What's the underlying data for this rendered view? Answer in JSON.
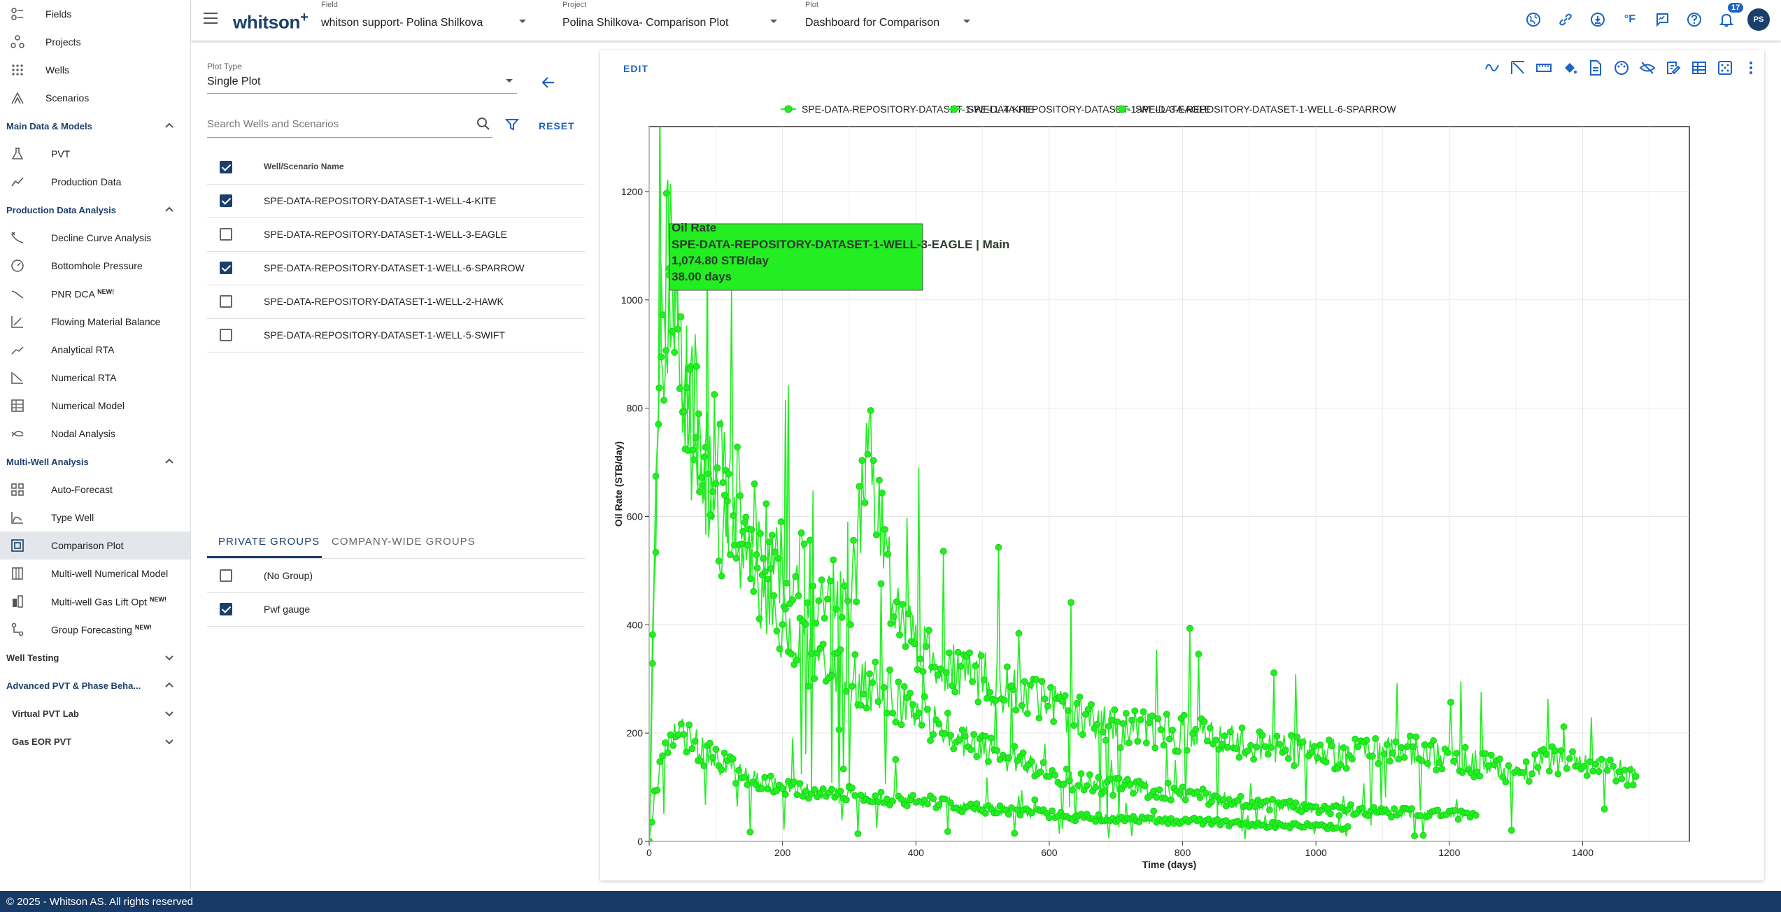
{
  "sidebar": {
    "top_items": [
      {
        "label": "Fields",
        "icon": "fields-icon"
      },
      {
        "label": "Projects",
        "icon": "projects-icon"
      },
      {
        "label": "Wells",
        "icon": "wells-icon"
      },
      {
        "label": "Scenarios",
        "icon": "scenarios-icon"
      }
    ],
    "sections": {
      "main_data": "Main Data & Models",
      "pda": "Production Data Analysis",
      "multi_well": "Multi-Well Analysis",
      "well_testing": "Well Testing",
      "advanced_pvt": "Advanced PVT & Phase Beha...",
      "virtual_pvt": "Virtual PVT Lab",
      "gas_eor": "Gas EOR PVT"
    },
    "main_items": [
      {
        "label": "PVT",
        "icon": "flask-icon"
      },
      {
        "label": "Production Data",
        "icon": "line-chart-icon"
      }
    ],
    "pda_items": [
      {
        "label": "Decline Curve Analysis",
        "icon": "decline-curve-icon"
      },
      {
        "label": "Bottomhole Pressure",
        "icon": "gauge-icon"
      },
      {
        "label": "PNR DCA",
        "badge": "NEW!",
        "icon": "pnr-icon"
      },
      {
        "label": "Flowing Material Balance",
        "icon": "fmb-icon"
      },
      {
        "label": "Analytical RTA",
        "icon": "analytical-rta-icon"
      },
      {
        "label": "Numerical RTA",
        "icon": "numerical-rta-icon"
      },
      {
        "label": "Numerical Model",
        "icon": "grid-model-icon"
      },
      {
        "label": "Nodal Analysis",
        "icon": "nodal-icon"
      }
    ],
    "mwa_items": [
      {
        "label": "Auto-Forecast",
        "icon": "dashboard-grid-icon"
      },
      {
        "label": "Type Well",
        "icon": "type-well-icon"
      },
      {
        "label": "Comparison Plot",
        "icon": "comparison-plot-icon"
      },
      {
        "label": "Multi-well Numerical Model",
        "icon": "multiwell-model-icon"
      },
      {
        "label": "Multi-well Gas Lift Opt",
        "badge": "NEW!",
        "icon": "gas-lift-icon"
      },
      {
        "label": "Group Forecasting",
        "badge": "NEW!",
        "icon": "group-forecast-icon"
      }
    ]
  },
  "header": {
    "logo": "whitson",
    "logo_sup": "+",
    "field": {
      "caption": "Field",
      "value": "whitson support- Polina Shilkova"
    },
    "project": {
      "caption": "Project",
      "value": "Polina Shilkova- Comparison Plot"
    },
    "plot": {
      "caption": "Plot",
      "value": "Dashboard for Comparison"
    },
    "notifications": "17",
    "user_initials": "PS",
    "unit_label": "°F"
  },
  "panel": {
    "plot_type_caption": "Plot Type",
    "plot_type_value": "Single Plot",
    "search_placeholder": "Search Wells and Scenarios",
    "reset_label": "RESET",
    "table_header": "Well/Scenario Name",
    "wells": [
      {
        "name": "SPE-DATA-REPOSITORY-DATASET-1-WELL-4-KITE",
        "checked": true
      },
      {
        "name": "SPE-DATA-REPOSITORY-DATASET-1-WELL-3-EAGLE",
        "checked": false
      },
      {
        "name": "SPE-DATA-REPOSITORY-DATASET-1-WELL-6-SPARROW",
        "checked": true
      },
      {
        "name": "SPE-DATA-REPOSITORY-DATASET-1-WELL-2-HAWK",
        "checked": false
      },
      {
        "name": "SPE-DATA-REPOSITORY-DATASET-1-WELL-5-SWIFT",
        "checked": false
      }
    ],
    "tabs": {
      "private": "PRIVATE GROUPS",
      "company": "COMPANY-WIDE GROUPS"
    },
    "groups": [
      {
        "name": "(No Group)",
        "checked": false
      },
      {
        "name": "Pwf gauge",
        "checked": true
      }
    ]
  },
  "card": {
    "edit_label": "EDIT",
    "toolbar_icons": [
      "curve-icon",
      "decline-line-icon",
      "ruler-icon",
      "fill-color-icon",
      "document-icon",
      "palette-icon",
      "hide-icon",
      "edit-note-icon",
      "table-icon",
      "dice-icon",
      "more-vert-icon"
    ]
  },
  "colors": {
    "series": "#22ee22",
    "marker_edge": "#11cc11",
    "brand": "#1b3f6b",
    "accent": "#1e63c4",
    "tooltip_bg": "#22ee22"
  },
  "chart_data": {
    "type": "scatter",
    "xlabel": "Time (days)",
    "ylabel": "Oil Rate (STB/day)",
    "xlim": [
      0,
      1560
    ],
    "ylim": [
      0,
      1320
    ],
    "x_ticks": [
      0,
      200,
      400,
      600,
      800,
      1000,
      1200,
      1400
    ],
    "y_ticks": [
      0,
      200,
      400,
      600,
      800,
      1000,
      1200
    ],
    "grid": true,
    "legend_position": "top",
    "series": [
      {
        "name": "SPE-DATA-REPOSITORY-DATASET-1-WELL-4-KITE",
        "x": [
          0,
          5,
          10,
          15,
          20,
          25,
          30,
          40,
          50,
          60,
          80,
          100,
          130,
          160,
          200,
          250,
          300,
          330,
          360,
          400,
          450,
          500,
          550,
          600,
          650,
          700,
          750,
          800,
          850,
          900,
          950,
          1000,
          1050,
          1100,
          1150,
          1200,
          1250,
          1280,
          1300,
          1350,
          1400,
          1450,
          1480
        ],
        "y": [
          0,
          400,
          700,
          900,
          1000,
          1060,
          1000,
          950,
          880,
          840,
          760,
          700,
          630,
          560,
          520,
          470,
          430,
          700,
          480,
          380,
          320,
          300,
          270,
          250,
          230,
          210,
          205,
          200,
          190,
          180,
          170,
          165,
          160,
          170,
          165,
          155,
          140,
          130,
          120,
          150,
          140,
          130,
          120
        ]
      },
      {
        "name": "SPE-DATA-REPOSITORY-DATASET-1-WELL-3-EAGLE",
        "x": [
          0,
          5,
          10,
          20,
          30,
          38,
          50,
          70,
          100,
          150,
          200,
          250,
          300,
          350,
          400,
          450,
          500,
          550,
          600,
          650,
          700,
          750,
          800,
          850,
          900,
          950,
          1000,
          1050,
          1100,
          1150,
          1200,
          1240
        ],
        "y": [
          0,
          300,
          600,
          900,
          1250,
          1075,
          880,
          700,
          600,
          500,
          400,
          330,
          300,
          280,
          240,
          200,
          170,
          150,
          120,
          110,
          100,
          95,
          90,
          80,
          70,
          65,
          60,
          58,
          55,
          52,
          50,
          48
        ]
      },
      {
        "name": "SPE-DATA-REPOSITORY-DATASET-1-WELL-6-SPARROW",
        "x": [
          0,
          10,
          20,
          30,
          40,
          50,
          60,
          80,
          100,
          130,
          160,
          200,
          250,
          300,
          350,
          400,
          450,
          500,
          550,
          600,
          650,
          700,
          750,
          800,
          850,
          900,
          950,
          1000,
          1050
        ],
        "y": [
          0,
          100,
          150,
          180,
          200,
          210,
          190,
          170,
          150,
          130,
          110,
          100,
          90,
          85,
          80,
          75,
          70,
          60,
          55,
          50,
          45,
          42,
          40,
          38,
          35,
          32,
          30,
          28,
          25
        ]
      }
    ],
    "tooltip": {
      "title": "Oil Rate",
      "series": "SPE-DATA-REPOSITORY-DATASET-1-WELL-3-EAGLE | Main",
      "value": "1,074.80 STB/day",
      "time": "38.00 days"
    }
  },
  "footer": {
    "text": "© 2025 - Whitson AS. All rights reserved"
  }
}
